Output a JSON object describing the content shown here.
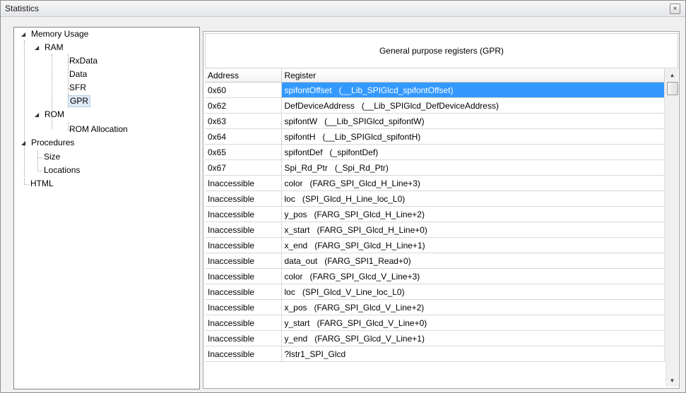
{
  "window": {
    "title": "Statistics",
    "close_glyph": "×"
  },
  "tree": {
    "memory_usage": "Memory Usage",
    "ram": "RAM",
    "rxdata": "RxData",
    "data": "Data",
    "sfr": "SFR",
    "gpr": "GPR",
    "rom": "ROM",
    "rom_allocation": "ROM Allocation",
    "procedures": "Procedures",
    "size": "Size",
    "locations": "Locations",
    "html": "HTML",
    "expander_glyph": "◢",
    "selected": "GPR"
  },
  "panel": {
    "heading": "General purpose registers (GPR)",
    "columns": {
      "address": "Address",
      "register": "Register"
    },
    "rows": [
      {
        "address": "0x60",
        "register": "spifontOffset   (__Lib_SPIGlcd_spifontOffset)"
      },
      {
        "address": "0x62",
        "register": "DefDeviceAddress   (__Lib_SPIGlcd_DefDeviceAddress)"
      },
      {
        "address": "0x63",
        "register": "spifontW   (__Lib_SPIGlcd_spifontW)"
      },
      {
        "address": "0x64",
        "register": "spifontH   (__Lib_SPIGlcd_spifontH)"
      },
      {
        "address": "0x65",
        "register": "spifontDef   (_spifontDef)"
      },
      {
        "address": "0x67",
        "register": "Spi_Rd_Ptr   (_Spi_Rd_Ptr)"
      },
      {
        "address": "Inaccessible",
        "register": "color   (FARG_SPI_Glcd_H_Line+3)"
      },
      {
        "address": "Inaccessible",
        "register": "loc   (SPI_Glcd_H_Line_loc_L0)"
      },
      {
        "address": "Inaccessible",
        "register": "y_pos   (FARG_SPI_Glcd_H_Line+2)"
      },
      {
        "address": "Inaccessible",
        "register": "x_start   (FARG_SPI_Glcd_H_Line+0)"
      },
      {
        "address": "Inaccessible",
        "register": "x_end   (FARG_SPI_Glcd_H_Line+1)"
      },
      {
        "address": "Inaccessible",
        "register": "data_out   (FARG_SPI1_Read+0)"
      },
      {
        "address": "Inaccessible",
        "register": "color   (FARG_SPI_Glcd_V_Line+3)"
      },
      {
        "address": "Inaccessible",
        "register": "loc   (SPI_Glcd_V_Line_loc_L0)"
      },
      {
        "address": "Inaccessible",
        "register": "x_pos   (FARG_SPI_Glcd_V_Line+2)"
      },
      {
        "address": "Inaccessible",
        "register": "y_start   (FARG_SPI_Glcd_V_Line+0)"
      },
      {
        "address": "Inaccessible",
        "register": "y_end   (FARG_SPI_Glcd_V_Line+1)"
      },
      {
        "address": "Inaccessible",
        "register": "?lstr1_SPI_Glcd"
      }
    ],
    "selected_row": 0
  },
  "scrollbar": {
    "up_glyph": "▲",
    "down_glyph": "▼"
  },
  "colors": {
    "selection": "#3399ff",
    "tree_border": "#828790"
  }
}
